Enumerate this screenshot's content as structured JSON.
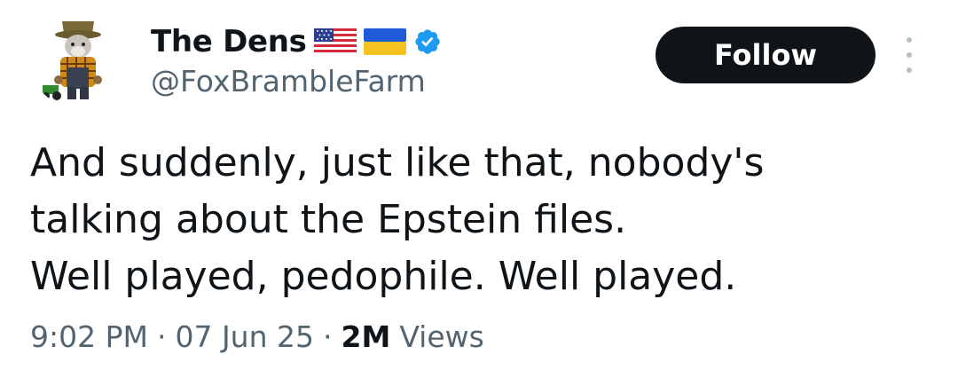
{
  "author": {
    "display_name": "The Dens",
    "handle": "@FoxBrambleFarm",
    "flags": [
      "us-flag-icon",
      "ukraine-flag-icon"
    ],
    "verified_icon": "verified-badge-icon",
    "avatar": "avatar-farmer-fox-cartoon"
  },
  "actions": {
    "follow_label": "Follow",
    "more_icon": "more-options-icon"
  },
  "tweet": {
    "lines": [
      "And suddenly, just like that, nobody's",
      "talking about the Epstein files.",
      "Well played, pedophile. Well played."
    ]
  },
  "meta": {
    "time": "9:02 PM",
    "separator": "·",
    "date": "07 Jun 25",
    "views_count": "2M",
    "views_label": "Views"
  },
  "colors": {
    "text_primary": "#0f1419",
    "text_secondary": "#536471",
    "follow_bg": "#0f1419",
    "follow_text": "#ffffff",
    "verified_blue": "#1d9bf0",
    "more_dots": "#b4bfc7"
  }
}
